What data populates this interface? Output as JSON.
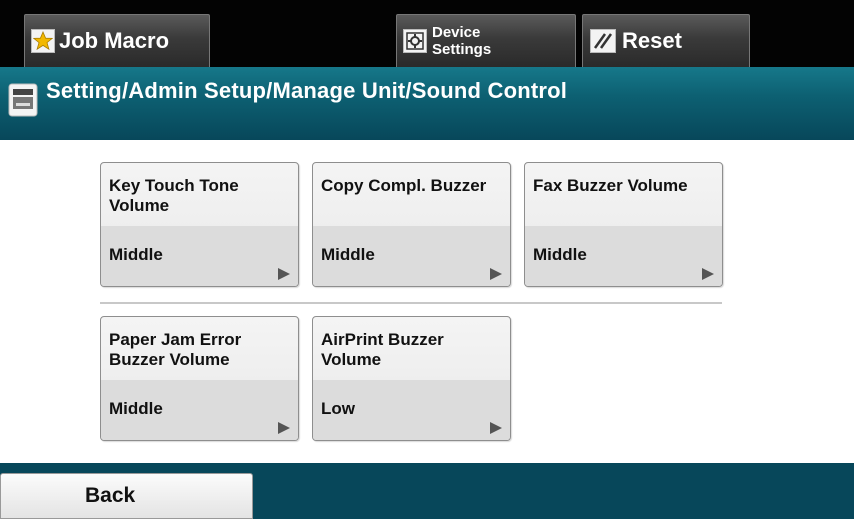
{
  "topbar": {
    "job_macro": "Job Macro",
    "device_settings_line1": "Device",
    "device_settings_line2": "Settings",
    "reset": "Reset"
  },
  "titlebar": {
    "title": "Setting/Admin Setup/Manage Unit/Sound Control"
  },
  "tiles": [
    {
      "label": "Key Touch Tone Volume",
      "value": "Middle"
    },
    {
      "label": "Copy Compl. Buzzer",
      "value": "Middle"
    },
    {
      "label": "Fax Buzzer Volume",
      "value": "Middle"
    },
    {
      "label": "Paper Jam Error Buzzer Volume",
      "value": "Middle"
    },
    {
      "label": "AirPrint Buzzer Volume",
      "value": "Low"
    }
  ],
  "bottombar": {
    "back": "Back"
  },
  "icons": {
    "job_macro": "star-icon",
    "device_settings": "device-settings-icon",
    "reset": "reset-icon",
    "title": "printer-icon",
    "tile_arrow": "triangle-right-icon"
  },
  "colors": {
    "topbar_bg": "#030303",
    "titlebar_bg": "#0d6072",
    "bottombar_bg": "#07475a",
    "star": "#f2b800"
  }
}
